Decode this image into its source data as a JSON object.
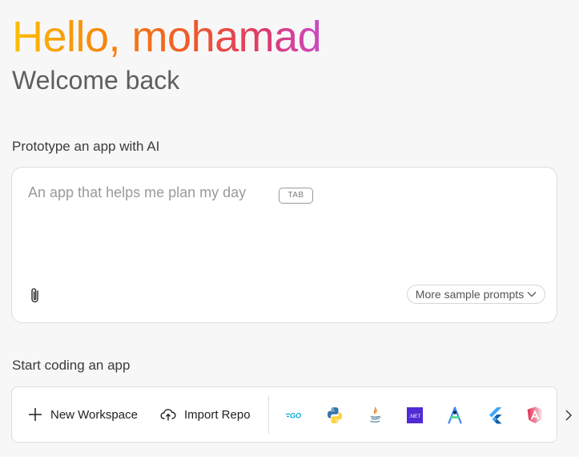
{
  "header": {
    "greeting": "Hello, mohamad",
    "subtitle": "Welcome back"
  },
  "prototype": {
    "heading": "Prototype an app with AI",
    "placeholder": "An app that helps me plan my day",
    "tab_hint": "TAB",
    "sample_prompts_label": "More sample prompts",
    "attach_icon": "paperclip-icon"
  },
  "start_coding": {
    "heading": "Start coding an app",
    "new_workspace_label": "New Workspace",
    "import_repo_label": "Import Repo",
    "templates": [
      {
        "icon": "go-icon",
        "label": "GO"
      },
      {
        "icon": "python-icon",
        "label": ""
      },
      {
        "icon": "java-icon",
        "label": ""
      },
      {
        "icon": "dotnet-icon",
        "label": ".NET"
      },
      {
        "icon": "android-studio-icon",
        "label": ""
      },
      {
        "icon": "flutter-icon",
        "label": ""
      },
      {
        "icon": "angular-icon",
        "label": ""
      }
    ],
    "next_icon": "chevron-right-icon"
  },
  "colors": {
    "background": "#f8f7f8",
    "gradient": [
      "#fbbf06",
      "#f7850c",
      "#f0592a",
      "#dd3a6e",
      "#c84bc5"
    ],
    "go": "#00acd7",
    "dotnet": "#512bd4",
    "flutter": "#42a5f5",
    "angular": "#dd0031"
  }
}
